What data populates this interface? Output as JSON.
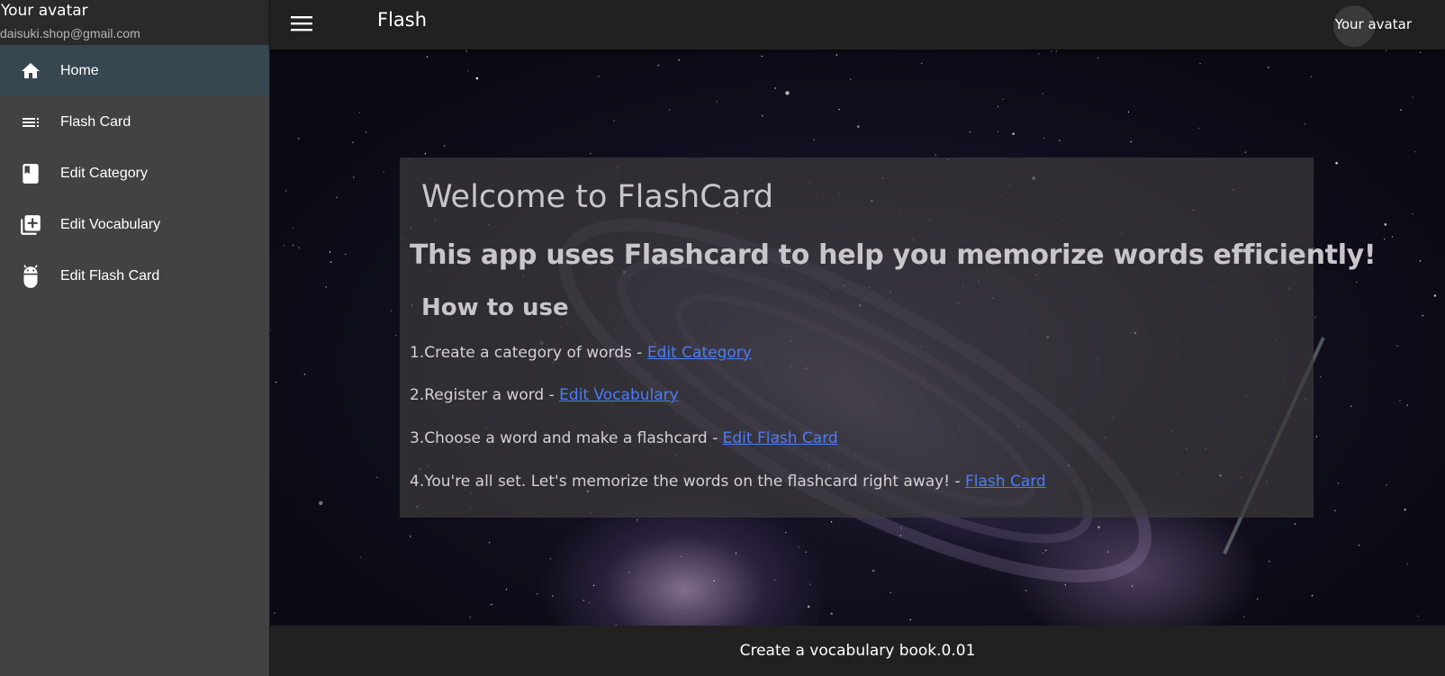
{
  "drawer": {
    "profile_name": "Your avatar",
    "profile_email": "daisuki.shop@gmail.com",
    "items": [
      {
        "label": "Home",
        "icon": "home-icon",
        "active": true
      },
      {
        "label": "Flash Card",
        "icon": "list-icon",
        "active": false
      },
      {
        "label": "Edit Category",
        "icon": "book-icon",
        "active": false
      },
      {
        "label": "Edit Vocabulary",
        "icon": "library-add-icon",
        "active": false
      },
      {
        "label": "Edit Flash Card",
        "icon": "android-icon",
        "active": false
      }
    ]
  },
  "appbar": {
    "title": "Flash",
    "avatar_label": "Your avatar",
    "menu_icon": "menu-icon"
  },
  "main": {
    "welcome_title": "Welcome to FlashCard",
    "subtitle": "This app uses Flashcard to help you memorize words efficiently!",
    "how_to_title": "How to use",
    "steps": [
      {
        "text": "1.Create a category of words - ",
        "link": "Edit Category"
      },
      {
        "text": "2.Register a word - ",
        "link": "Edit Vocabulary"
      },
      {
        "text": "3.Choose a word and make a flashcard - ",
        "link": "Edit Flash Card"
      },
      {
        "text": "4.You're all set. Let's memorize the words on the flashcard right away! - ",
        "link": "Flash Card"
      }
    ]
  },
  "footer": {
    "text": "Create a vocabulary book.0.01"
  },
  "colors": {
    "drawer_bg": "#424242",
    "active_item_bg": "#37474f",
    "appbar_bg": "#212121",
    "link": "#4c7cf5",
    "card_bg": "#3c3a3c"
  }
}
